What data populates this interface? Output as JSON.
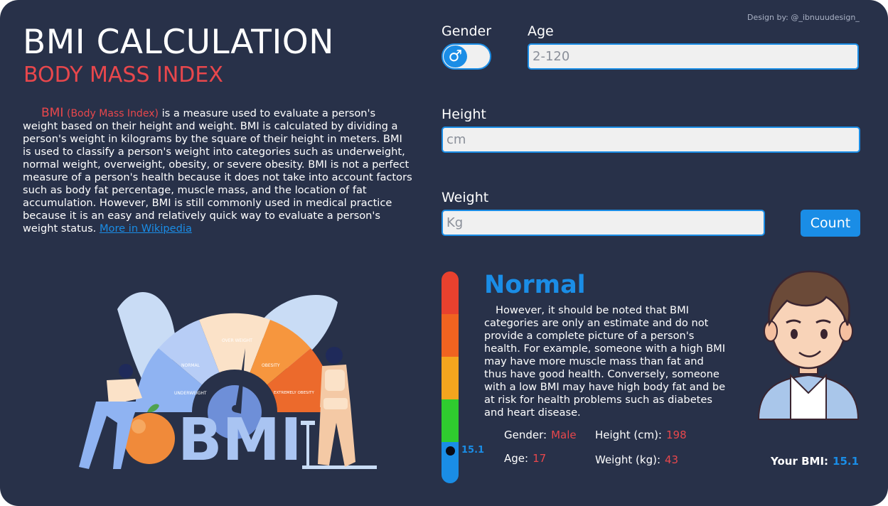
{
  "credit": "Design by:  @_ibnuuudesign_",
  "header": {
    "title": "BMI CALCULATION",
    "subtitle": "BODY MASS INDEX"
  },
  "description": {
    "bmi_word": "BMI",
    "bmi_paren": "(Body Mass Index)",
    "text": " is a measure used to evaluate a person's weight based on their height and weight. BMI is calculated by dividing a person's weight in kilograms by the square of their height in meters. BMI is used to classify a person's weight into categories such as underweight, normal weight, overweight, obesity, or severe obesity. BMI is not a perfect measure of a person's health because it does not take into account factors such as body fat percentage, muscle mass, and the location of fat accumulation. However, BMI is still commonly used in medical practice because it is an easy and relatively quick way to evaluate a person's weight status. ",
    "link_text": "More in Wikipedia"
  },
  "form": {
    "gender_label": "Gender",
    "gender_icon": "male-symbol-icon",
    "gender_glyph": "♂",
    "age_label": "Age",
    "age_placeholder": "2-120",
    "height_label": "Height",
    "height_placeholder": "cm",
    "weight_label": "Weight",
    "weight_placeholder": "Kg",
    "count_label": "Count"
  },
  "illustration": {
    "gauge_labels": [
      "UNDERWEIGHT",
      "NORMAL",
      "OVER WEIGHT",
      "OBESITY",
      "EXTREMELY OBESITY"
    ],
    "big_text": "BMI"
  },
  "result": {
    "scale_colors": [
      "#e8412e",
      "#f06320",
      "#f4a51e",
      "#2fcc2f",
      "#1a8de6"
    ],
    "marker_value": "15.1",
    "status": "Normal",
    "note": "However, it should be noted that BMI categories are only an estimate and do not provide a complete picture of a person's health. For example, someone with a high BMI may have more muscle mass than fat and thus have good health. Conversely, someone with a low BMI may have high body fat and be at risk for health problems such as diabetes and heart disease.",
    "gender_label": "Gender:",
    "gender_value": "Male",
    "age_label": "Age:",
    "age_value": "17",
    "height_label": "Height (cm):",
    "height_value": "198",
    "weight_label": "Weight (kg):",
    "weight_value": "43",
    "your_bmi_label": "Your BMI:",
    "your_bmi_value": "15.1"
  },
  "colors": {
    "background": "#283149",
    "accent_blue": "#1a8de6",
    "accent_red": "#e8474c"
  }
}
